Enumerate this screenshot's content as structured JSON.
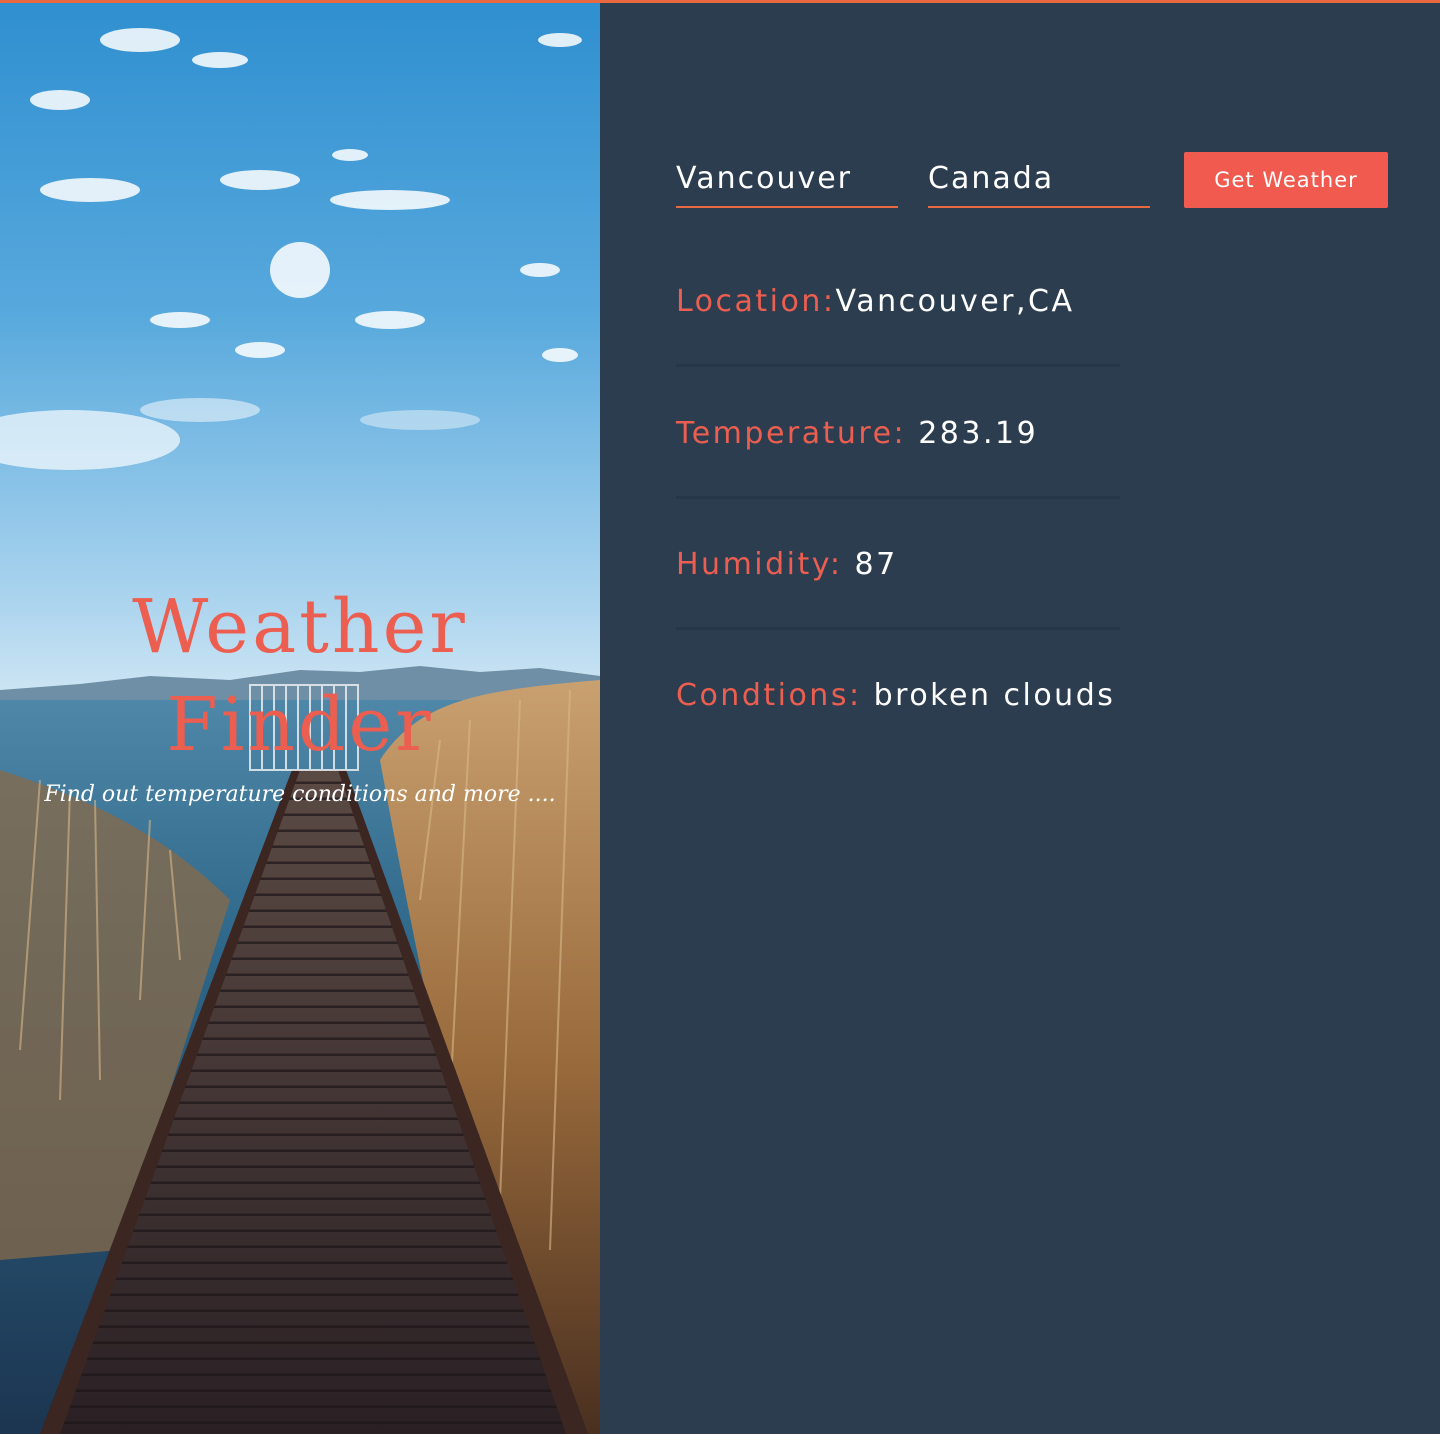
{
  "hero": {
    "title": "Weather Finder",
    "subtitle": "Find out temperature conditions and more ...."
  },
  "form": {
    "city_value": "Vancouver",
    "country_value": "Canada",
    "submit_label": "Get Weather"
  },
  "results": {
    "location_label": "Location:",
    "location_value": "Vancouver,CA",
    "temperature_label": "Temperature:",
    "temperature_value": "283.19",
    "humidity_label": "Humidity:",
    "humidity_value": "87",
    "conditions_label": "Condtions:",
    "conditions_value": "broken clouds"
  },
  "colors": {
    "accent": "#f15b4f",
    "panel_background": "#2c3e50",
    "top_bar": "#e8683f",
    "value_text": "#ffffff"
  }
}
